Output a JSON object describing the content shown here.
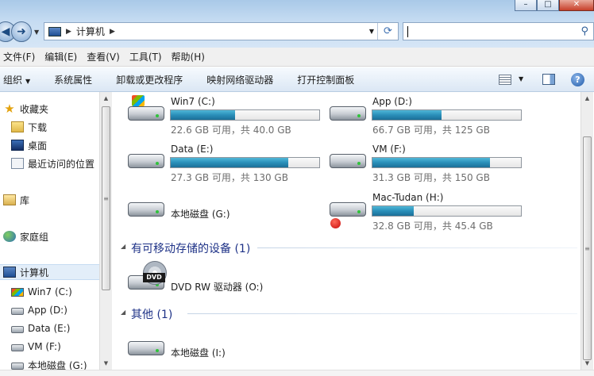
{
  "address": {
    "location": "计算机"
  },
  "search": {
    "placeholder": ""
  },
  "menu": [
    "文件(F)",
    "编辑(E)",
    "查看(V)",
    "工具(T)",
    "帮助(H)"
  ],
  "toolbar": {
    "organize": "组织",
    "system_properties": "系统属性",
    "uninstall": "卸载或更改程序",
    "map_drive": "映射网络驱动器",
    "control_panel": "打开控制面板"
  },
  "nav": {
    "favorites": "收藏夹",
    "downloads": "下载",
    "desktop": "桌面",
    "recent": "最近访问的位置",
    "libraries": "库",
    "homegroup": "家庭组",
    "computer": "计算机",
    "drives": [
      "Win7 (C:)",
      "App (D:)",
      "Data (E:)",
      "VM (F:)",
      "本地磁盘 (G:)"
    ]
  },
  "drives": [
    {
      "name": "Win7 (C:)",
      "info": "22.6 GB 可用，共 40.0 GB",
      "fill": 0.435,
      "icon": "windows-drive-icon"
    },
    {
      "name": "App (D:)",
      "info": "66.7 GB 可用，共 125 GB",
      "fill": 0.466,
      "icon": "hard-drive-icon"
    },
    {
      "name": "Data (E:)",
      "info": "27.3 GB 可用，共 130 GB",
      "fill": 0.79,
      "icon": "hard-drive-icon"
    },
    {
      "name": "VM (F:)",
      "info": "31.3 GB 可用，共 150 GB",
      "fill": 0.79,
      "icon": "hard-drive-icon"
    },
    {
      "name": "本地磁盘 (G:)",
      "info": "",
      "fill": null,
      "icon": "hard-drive-icon"
    },
    {
      "name": "Mac-Tudan (H:)",
      "info": "32.8 GB 可用，共 45.4 GB",
      "fill": 0.278,
      "icon": "mac-drive-icon"
    }
  ],
  "removable": {
    "header": "有可移动存储的设备 (1)",
    "dvd": {
      "name": "DVD RW 驱动器 (O:)",
      "badge": "DVD"
    }
  },
  "other": {
    "header": "其他 (1)",
    "drive": {
      "name": "本地磁盘 (I:)"
    }
  },
  "colors": {
    "bar_fill": "#2a8fb9",
    "group_header": "#1e3287"
  }
}
